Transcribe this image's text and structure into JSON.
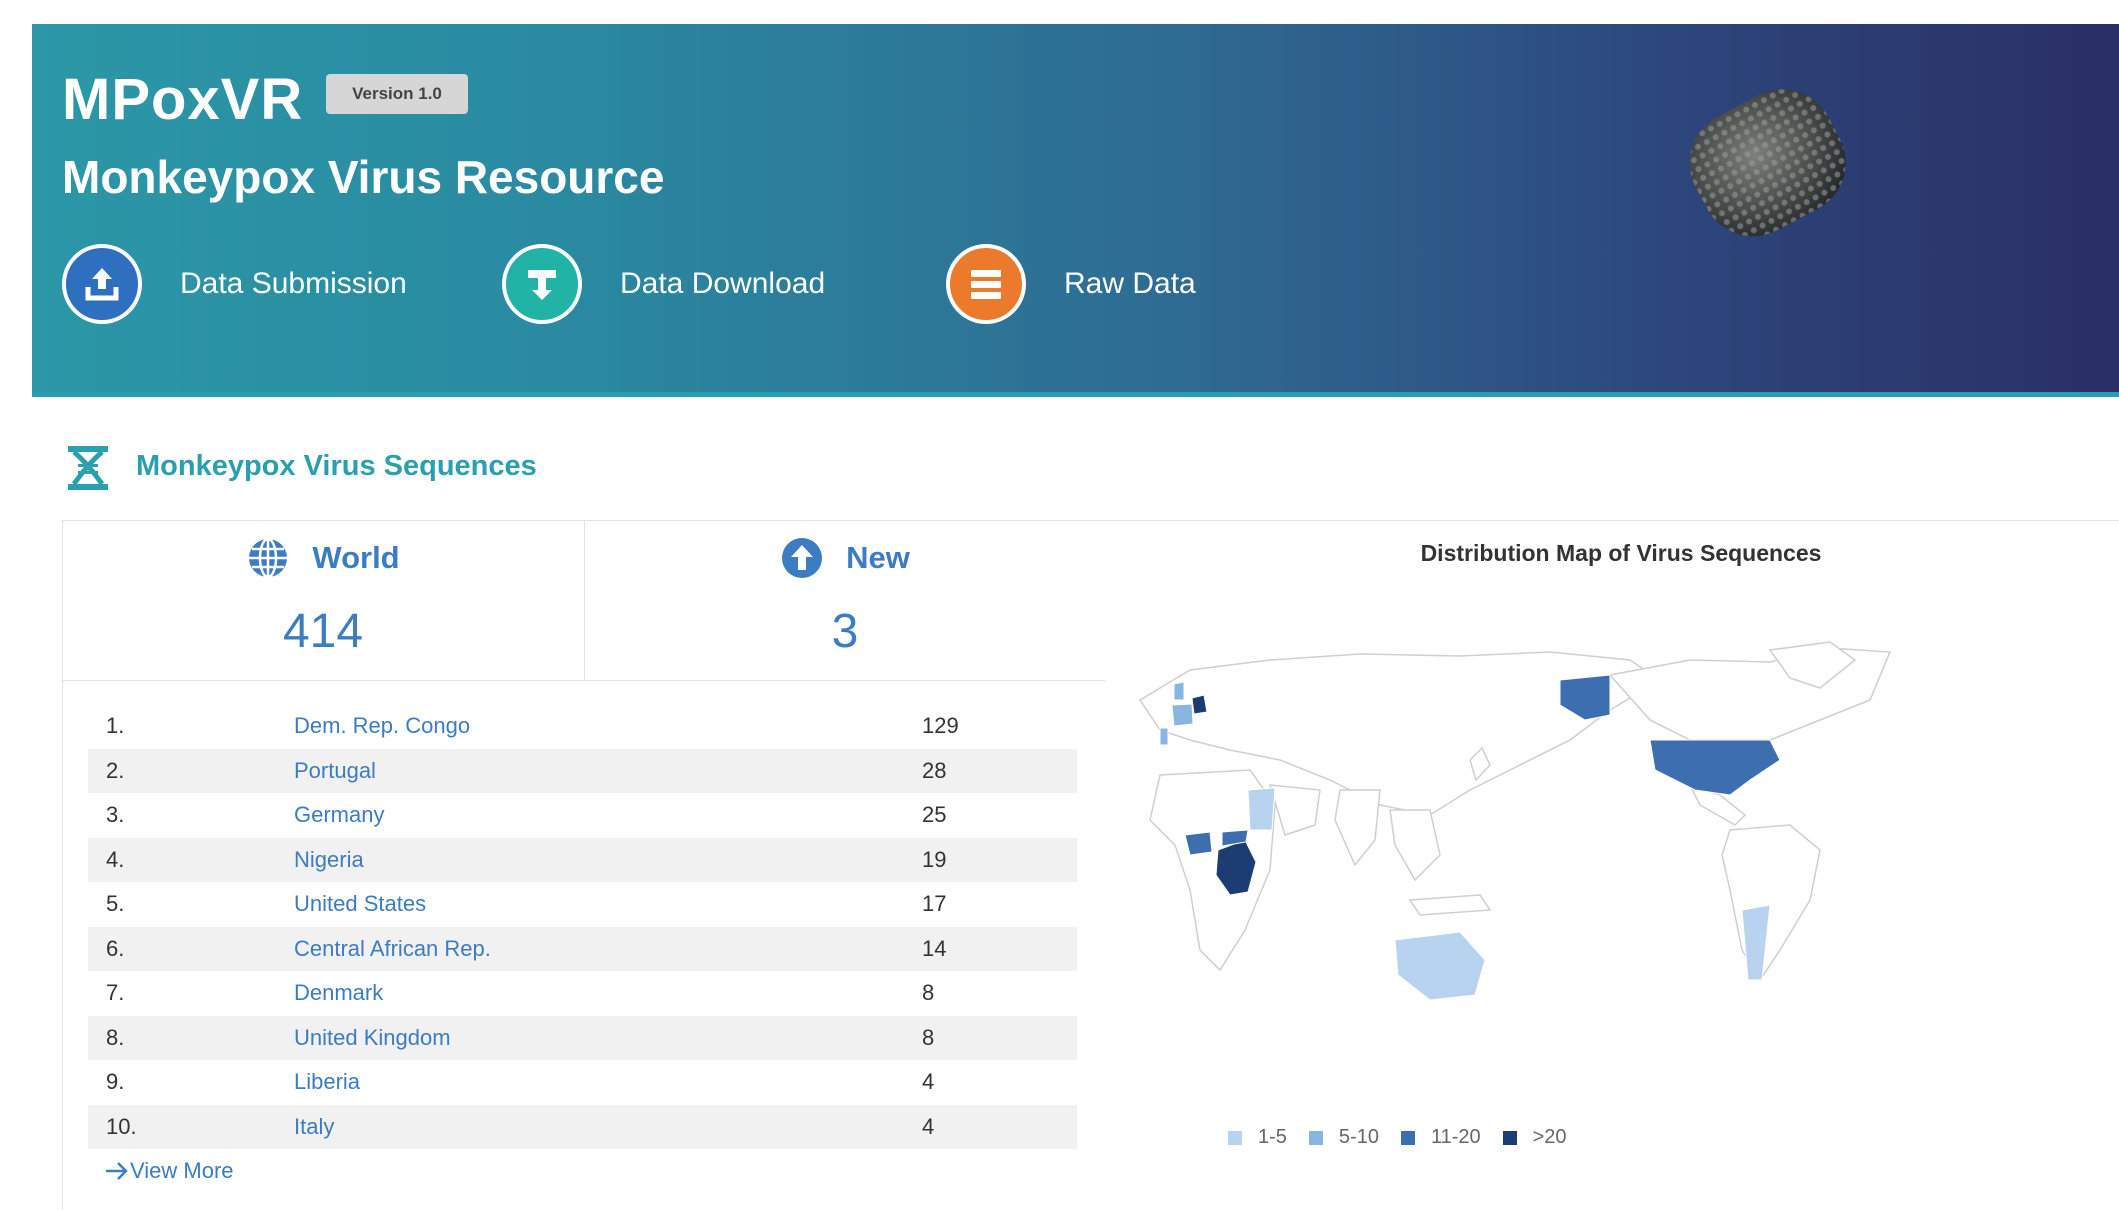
{
  "header": {
    "app_title": "MPoxVR",
    "version": "Version 1.0",
    "subtitle": "Monkeypox Virus Resource",
    "actions": [
      {
        "label": "Data Submission",
        "icon": "upload-icon",
        "color": "#2f6fc0"
      },
      {
        "label": "Data Download",
        "icon": "download-icon",
        "color": "#21b3a5"
      },
      {
        "label": "Raw Data",
        "icon": "database-icon",
        "color": "#ec7a2c"
      }
    ]
  },
  "section": {
    "title": "Monkeypox Virus Sequences",
    "icon": "dna-icon"
  },
  "stats": {
    "world": {
      "label": "World",
      "value": "414",
      "icon": "globe-icon"
    },
    "new": {
      "label": "New",
      "value": "3",
      "icon": "arrow-up-circle-icon"
    }
  },
  "ranking": [
    {
      "rank": "1.",
      "country": "Dem. Rep. Congo",
      "count": "129"
    },
    {
      "rank": "2.",
      "country": "Portugal",
      "count": "28"
    },
    {
      "rank": "3.",
      "country": "Germany",
      "count": "25"
    },
    {
      "rank": "4.",
      "country": "Nigeria",
      "count": "19"
    },
    {
      "rank": "5.",
      "country": "United States",
      "count": "17"
    },
    {
      "rank": "6.",
      "country": "Central African Rep.",
      "count": "14"
    },
    {
      "rank": "7.",
      "country": "Denmark",
      "count": "8"
    },
    {
      "rank": "8.",
      "country": "United Kingdom",
      "count": "8"
    },
    {
      "rank": "9.",
      "country": "Liberia",
      "count": "4"
    },
    {
      "rank": "10.",
      "country": "Italy",
      "count": "4"
    }
  ],
  "view_more": "View More",
  "map": {
    "title": "Distribution Map of Virus Sequences",
    "legend": [
      {
        "label": "1-5",
        "color": "#b7d3f0"
      },
      {
        "label": "5-10",
        "color": "#8ab4e2"
      },
      {
        "label": "11-20",
        "color": "#3d6fb0"
      },
      {
        "label": ">20",
        "color": "#1b3d73"
      }
    ]
  },
  "colors": {
    "accent": "#2a9fae",
    "link": "#3b7cc2"
  }
}
